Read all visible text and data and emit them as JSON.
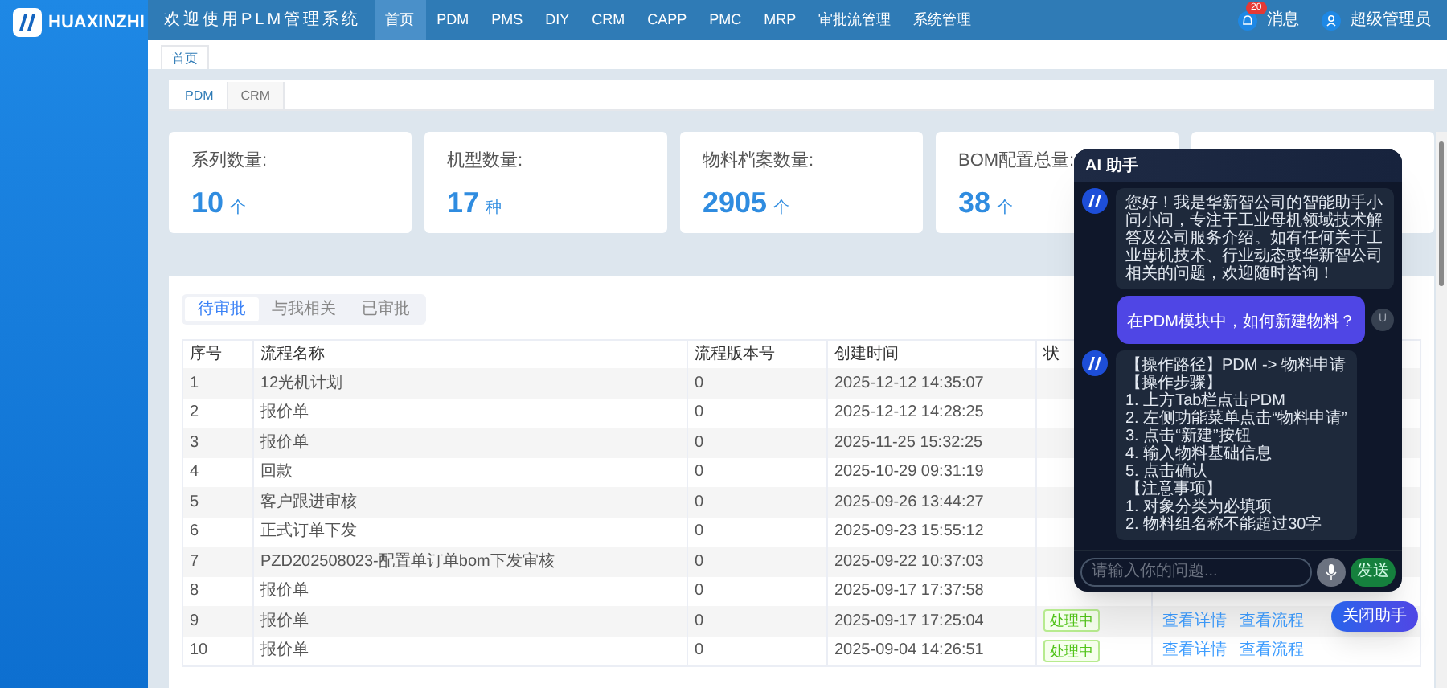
{
  "sidebar": {
    "logo_text": "HUAXINZHI"
  },
  "header": {
    "title": "欢迎使用PLM管理系统",
    "nav": [
      {
        "label": "首页",
        "selected": true
      },
      {
        "label": "PDM",
        "selected": false
      },
      {
        "label": "PMS",
        "selected": false
      },
      {
        "label": "DIY",
        "selected": false
      },
      {
        "label": "CRM",
        "selected": false
      },
      {
        "label": "CAPP",
        "selected": false
      },
      {
        "label": "PMC",
        "selected": false
      },
      {
        "label": "MRP",
        "selected": false
      },
      {
        "label": "审批流管理",
        "selected": false
      },
      {
        "label": "系统管理",
        "selected": false
      }
    ],
    "notifications": {
      "badge": "20",
      "label": "消息"
    },
    "user": "超级管理员"
  },
  "page_tabs": [
    {
      "label": "首页",
      "selected": true
    }
  ],
  "module_tabs": [
    {
      "label": "PDM",
      "selected": true
    },
    {
      "label": "CRM",
      "selected": false
    }
  ],
  "stats": [
    {
      "label": "系列数量:",
      "value": "10",
      "unit": "个"
    },
    {
      "label": "机型数量:",
      "value": "17",
      "unit": "种"
    },
    {
      "label": "物料档案数量:",
      "value": "2905",
      "unit": "个"
    },
    {
      "label": "BOM配置总量:",
      "value": "38",
      "unit": "个"
    }
  ],
  "approval_tabs": [
    {
      "label": "待审批",
      "selected": true
    },
    {
      "label": "与我相关",
      "selected": false
    },
    {
      "label": "已审批",
      "selected": false
    }
  ],
  "table": {
    "columns": [
      "序号",
      "流程名称",
      "流程版本号",
      "创建时间",
      "状"
    ],
    "rows": [
      {
        "cells": [
          "1",
          "12光机计划",
          "0",
          "2025-12-12 14:35:07"
        ]
      },
      {
        "cells": [
          "2",
          "报价单",
          "0",
          "2025-12-12 14:28:25"
        ]
      },
      {
        "cells": [
          "3",
          "报价单",
          "0",
          "2025-11-25 15:32:25"
        ]
      },
      {
        "cells": [
          "4",
          "回款",
          "0",
          "2025-10-29 09:31:19"
        ]
      },
      {
        "cells": [
          "5",
          "客户跟进审核",
          "0",
          "2025-09-26 13:44:27"
        ]
      },
      {
        "cells": [
          "6",
          "正式订单下发",
          "0",
          "2025-09-23 15:55:12"
        ]
      },
      {
        "cells": [
          "7",
          "PZD202508023-配置单订单bom下发审核",
          "0",
          "2025-09-22 10:37:03"
        ]
      },
      {
        "cells": [
          "8",
          "报价单",
          "0",
          "2025-09-17 17:37:58"
        ]
      },
      {
        "cells": [
          "9",
          "报价单",
          "0",
          "2025-09-17 17:25:04"
        ],
        "status": "处理中",
        "actions": [
          "查看详情",
          "查看流程"
        ]
      },
      {
        "cells": [
          "10",
          "报价单",
          "0",
          "2025-09-04 14:26:51"
        ],
        "status": "处理中",
        "actions": [
          "查看详情",
          "查看流程"
        ]
      }
    ]
  },
  "assistant": {
    "title": "AI 助手",
    "messages": [
      {
        "kind": "bot",
        "lines": [
          "您好！我是华新智公司的智能助手小问小问，专注于工业母机领域技术解答及公司服务介绍。如有任何关于工业母机技术、行业动态或华新智公司相关的问题，欢迎随时咨询！"
        ]
      },
      {
        "kind": "user",
        "lines": [
          "在PDM模块中，如何新建物料？"
        ],
        "avatar": "U"
      },
      {
        "kind": "bot",
        "lines": [
          "【操作路径】PDM -> 物料申请",
          "【操作步骤】",
          "1. 上方Tab栏点击PDM",
          "2. 左侧功能菜单点击“物料申请”",
          "3. 点击“新建”按钮",
          "4. 输入物料基础信息",
          "5. 点击确认",
          "【注意事项】",
          "1. 对象分类为必填项",
          "2. 物料组名称不能超过30字"
        ]
      }
    ],
    "input_placeholder": "请输入你的问题...",
    "send_label": "发送",
    "close_button": "关闭助手"
  }
}
